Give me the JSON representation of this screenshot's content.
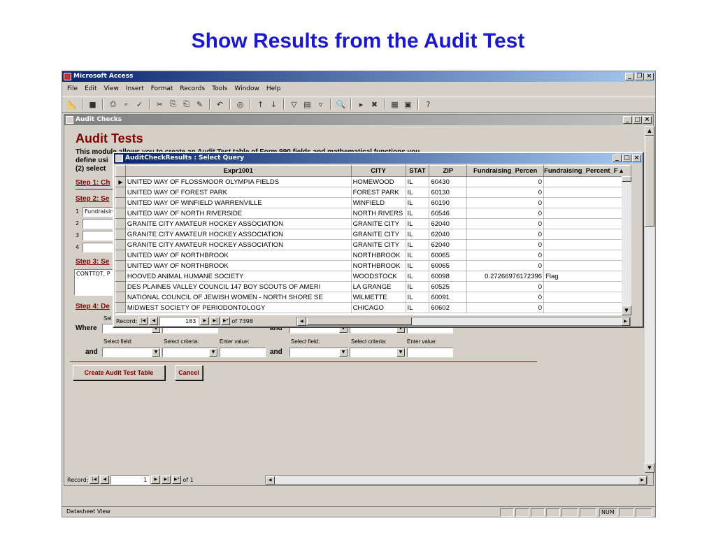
{
  "slide_title": "Show Results from the Audit Test",
  "app": {
    "title": "Microsoft Access",
    "menu": [
      "File",
      "Edit",
      "View",
      "Insert",
      "Format",
      "Records",
      "Tools",
      "Window",
      "Help"
    ]
  },
  "form": {
    "window_title": "Audit Checks",
    "heading": "Audit Tests",
    "intro_line1": "This module allows you to create an Audit Test table of Form 990 fields and mathematical functions you",
    "intro_line2": "define usi",
    "intro_line3": "(2) select",
    "step1": "Step 1: Ch",
    "step2": "Step 2: Se",
    "step3": "Step 3: Se",
    "step4": "Step 4: De",
    "field_rows": [
      {
        "num": "1",
        "value": "Fundraisin"
      },
      {
        "num": "2",
        "value": ""
      },
      {
        "num": "3",
        "value": ""
      },
      {
        "num": "4",
        "value": ""
      }
    ],
    "step3_text": "CONTTOT, P",
    "sel_fragment": "Sel",
    "where_label": "Where",
    "and_label": "and",
    "select_field_label": "Select field:",
    "select_criteria_label": "Select criteria:",
    "enter_value_label": "Enter value:",
    "create_button": "Create Audit Test Table",
    "cancel_button": "Cancel",
    "record_label": "Record:",
    "record_current": "1",
    "record_of": "of  1"
  },
  "query": {
    "window_title": "AuditCheckResults : Select Query",
    "columns": [
      "Expr1001",
      "CITY",
      "STAT",
      "ZIP",
      "Fundraising_Percen",
      "Fundraising_Percent_F"
    ],
    "rows": [
      [
        "UNITED WAY OF FLOSSMOOR  OLYMPIA FIELDS",
        "HOMEWOOD",
        "IL",
        "60430",
        "0",
        ""
      ],
      [
        "UNITED WAY OF FOREST PARK",
        "FOREST PARK",
        "IL",
        "60130",
        "0",
        ""
      ],
      [
        "UNITED WAY OF WINFIELD WARRENVILLE",
        "WINFIELD",
        "IL",
        "60190",
        "0",
        ""
      ],
      [
        "UNITED WAY OF NORTH RIVERSIDE",
        "NORTH RIVERS",
        "IL",
        "60546",
        "0",
        ""
      ],
      [
        "GRANITE CITY AMATEUR HOCKEY ASSOCIATION",
        "GRANITE CITY",
        "IL",
        "62040",
        "0",
        ""
      ],
      [
        "GRANITE CITY AMATEUR HOCKEY ASSOCIATION",
        "GRANITE CITY",
        "IL",
        "62040",
        "0",
        ""
      ],
      [
        "GRANITE CITY AMATEUR HOCKEY ASSOCIATION",
        "GRANITE CITY",
        "IL",
        "62040",
        "0",
        ""
      ],
      [
        "UNITED WAY OF NORTHBROOK",
        "NORTHBROOK",
        "IL",
        "60065",
        "0",
        ""
      ],
      [
        "UNITED WAY OF NORTHBROOK",
        "NORTHBROOK",
        "IL",
        "60065",
        "0",
        ""
      ],
      [
        "HOOVED ANIMAL HUMANE SOCIETY",
        "WOODSTOCK",
        "IL",
        "60098",
        "0.27266976172396",
        "Flag"
      ],
      [
        "DES PLAINES VALLEY COUNCIL 147 BOY SCOUTS OF AMERI",
        "LA GRANGE",
        "IL",
        "60525",
        "0",
        ""
      ],
      [
        "NATIONAL COUNCIL OF JEWISH WOMEN - NORTH SHORE SE",
        "WILMETTE",
        "IL",
        "60091",
        "0",
        ""
      ],
      [
        "MIDWEST SOCIETY OF PERIODONTOLOGY",
        "CHICAGO",
        "IL",
        "60602",
        "0",
        ""
      ]
    ],
    "record_label": "Record:",
    "record_current": "183",
    "record_of": "of  7398"
  },
  "status": {
    "left": "Datasheet View",
    "num": "NUM"
  }
}
